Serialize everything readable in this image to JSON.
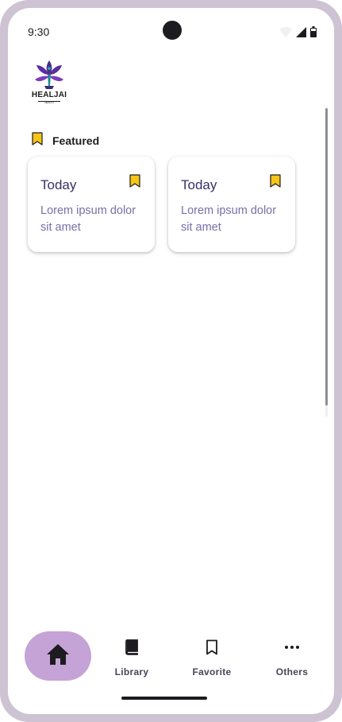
{
  "status_bar": {
    "time": "9:30",
    "icons": [
      "wifi-icon",
      "signal-icon",
      "battery-icon"
    ]
  },
  "brand": {
    "name": "HEALJAI",
    "tagline": "HEALTH"
  },
  "featured": {
    "label": "Featured",
    "icon": "bookmark-filled-icon",
    "cards": [
      {
        "title": "Today",
        "description": "Lorem ipsum dolor sit amet",
        "icon": "bookmark-filled-icon"
      },
      {
        "title": "Today",
        "description": "Lorem ipsum dolor sit amet",
        "icon": "bookmark-filled-icon"
      }
    ]
  },
  "bottom_nav": {
    "items": [
      {
        "label": "",
        "icon": "home-icon",
        "active": true
      },
      {
        "label": "Library",
        "icon": "book-icon"
      },
      {
        "label": "Favorite",
        "icon": "bookmark-outline-icon"
      },
      {
        "label": "Others",
        "icon": "more-horiz-icon"
      }
    ]
  },
  "colors": {
    "frame": "#cdc3d3",
    "active_pill": "#c5a3d6",
    "bookmark": "#f5c518",
    "card_title": "#3b2f66",
    "card_text": "#7b6ea6"
  }
}
